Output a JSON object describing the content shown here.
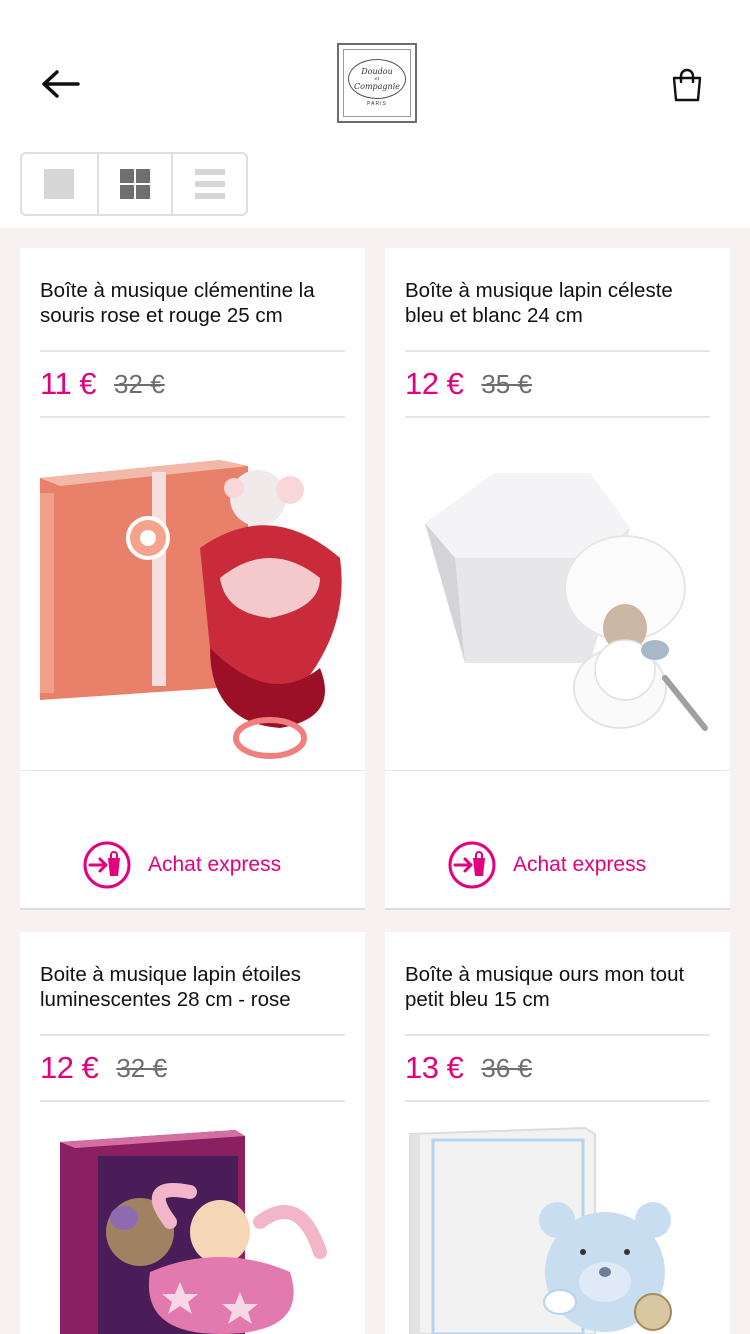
{
  "header": {
    "back_icon": "arrow-left-icon",
    "logo": {
      "line1": "Doudou",
      "line2": "et",
      "line3": "Compagnie",
      "sub": "PARIS"
    },
    "cart_icon": "shopping-bag-icon"
  },
  "view_options": [
    "single-view-icon",
    "grid-view-icon",
    "list-view-icon"
  ],
  "colors": {
    "accent": "#e4007c",
    "old_price": "#6e6e6e",
    "background": "#f7f1f1"
  },
  "products": [
    {
      "title": "Boîte à musique clémentine la souris rose et rouge 25 cm",
      "price": "11 €",
      "old_price": "32 €",
      "express_label": "Achat express"
    },
    {
      "title": "Boîte à musique lapin céleste bleu et blanc 24 cm",
      "price": "12 €",
      "old_price": "35 €",
      "express_label": "Achat express"
    },
    {
      "title": "Boite à musique lapin étoiles luminescentes 28 cm - rose",
      "price": "12 €",
      "old_price": "32 €"
    },
    {
      "title": "Boîte à musique ours mon tout petit bleu 15 cm",
      "price": "13 €",
      "old_price": "36 €"
    }
  ]
}
